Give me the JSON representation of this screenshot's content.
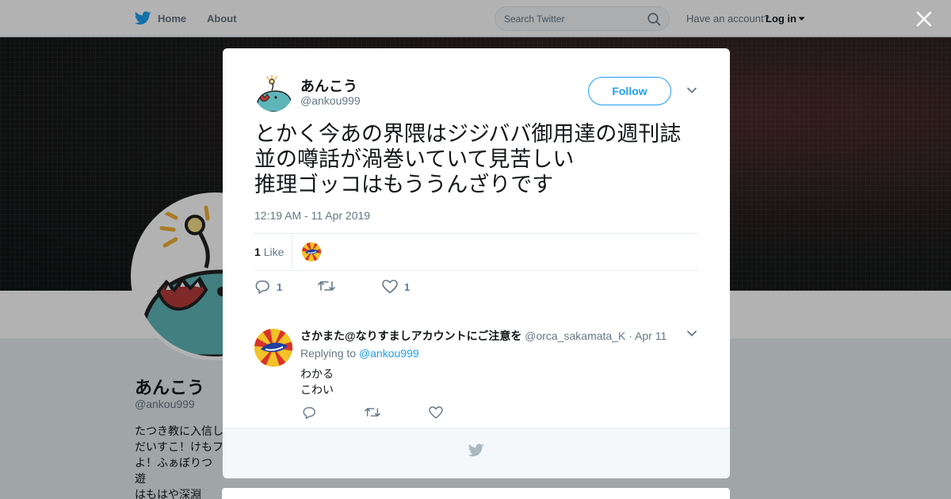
{
  "nav": {
    "home_label": "Home",
    "about_label": "About",
    "search_placeholder": "Search Twitter",
    "have_account": "Have an account?",
    "login_label": "Log in"
  },
  "background_profile": {
    "name": "あんこう",
    "handle": "@ankou999",
    "bio": "たつき教に入信し\nだいすこ！けもフ\nよ！ふぁぼりつ遊\nはもはや深淵"
  },
  "tweet": {
    "author_name": "あんこう",
    "author_handle": "@ankou999",
    "follow_label": "Follow",
    "text": "とかく今あの界隈はジジババ御用達の週刊誌\n並の噂話が渦巻いていて見苦しい\n推理ゴッコはもううんざりです",
    "timestamp": "12:19 AM - 11 Apr 2019",
    "like_count": "1",
    "like_word": "Like",
    "reply_count": "1",
    "favorite_count": "1"
  },
  "reply": {
    "author_name": "さかまた@なりすましアカウントにご注意を",
    "author_handle": "@orca_sakamata_K",
    "separator": "·",
    "date": "Apr 11",
    "replying_prefix": "Replying to",
    "replying_to": "@ankou999",
    "text": "わかる\nこわい"
  },
  "colors": {
    "accent": "#1da1f2",
    "text_primary": "#14171a",
    "text_secondary": "#657786",
    "angler_body": "#5fb6b9"
  },
  "icons": {
    "home": "twitter-bird-icon",
    "search": "search-icon",
    "close": "close-icon",
    "caret": "chevron-down-icon",
    "reply": "reply-icon",
    "retweet": "retweet-icon",
    "like": "heart-icon",
    "footer": "twitter-bird-icon"
  }
}
